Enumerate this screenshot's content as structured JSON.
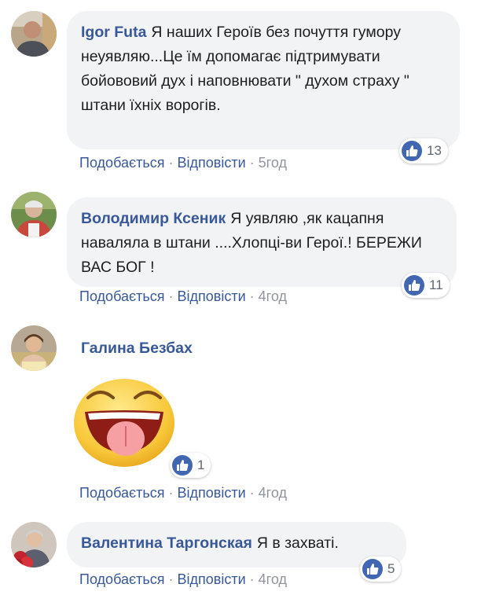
{
  "actions": {
    "like_label": "Подобається",
    "reply_label": "Відповісти",
    "separator": "·"
  },
  "colors": {
    "link": "#385898",
    "bubble": "#f2f3f5",
    "like_blue": "#4267b2",
    "meta_gray": "#90949c"
  },
  "comments": [
    {
      "author": "Igor Futa",
      "text": "Я наших Героїв без почуття гумору неуявляю...Це їм допомагає підтримувати бойововий дух і наповнювати \" духом страху \" штани їхніх ворогів.",
      "time": "5год",
      "likes": "13",
      "reaction_icon": "like-icon"
    },
    {
      "author": "Володимир Ксеник",
      "text": "Я уявляю ,як кацапня наваляла в штани ....Хлопці-ви Герої.! БЕРЕЖИ ВАС БОГ !",
      "time": "4год",
      "likes": "11",
      "reaction_icon": "like-icon"
    },
    {
      "author": "Галина Безбах",
      "text": "",
      "sticker": "tongue-out-emoji-sticker",
      "time": "4год",
      "likes": "1",
      "reaction_icon": "like-icon"
    },
    {
      "author": "Валентина Таргонская",
      "text": "Я в захваті.",
      "time": "4год",
      "likes": "5",
      "reaction_icon": "like-icon"
    }
  ]
}
